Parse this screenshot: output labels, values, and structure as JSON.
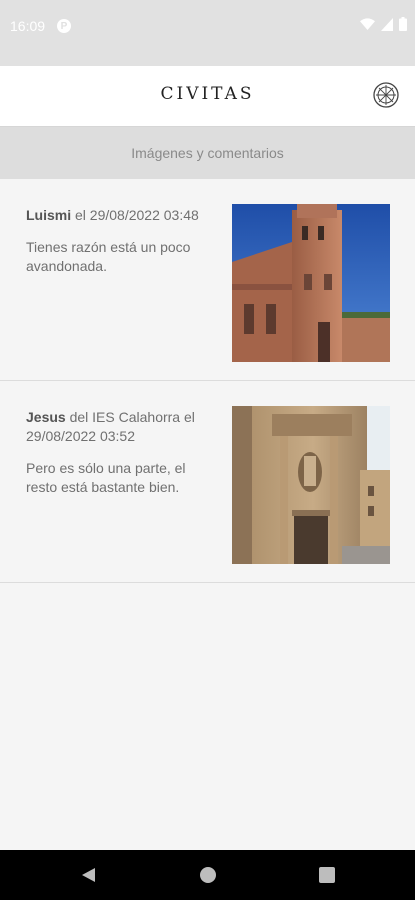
{
  "status_bar": {
    "time": "16:09",
    "notification_icon": "p-circle-icon",
    "icons": [
      "wifi-icon",
      "signal-icon",
      "battery-icon"
    ]
  },
  "app_bar": {
    "title": "CIVITAS",
    "logo_icon": "civitas-logo-icon"
  },
  "section": {
    "title": "Imágenes y comentarios"
  },
  "comments": [
    {
      "author": "Luismi",
      "meta": " el 29/08/2022 03:48",
      "text": "Tienes razón está un poco avandonada.",
      "image": "church-tower-photo"
    },
    {
      "author": "Jesus",
      "meta": " del IES Calahorra el 29/08/2022 03:52",
      "text": "Pero es sólo una parte, el resto está bastante bien.",
      "image": "cathedral-facade-photo"
    }
  ],
  "nav_bar": {
    "back": "back-icon",
    "home": "home-icon",
    "recents": "recents-icon"
  },
  "colors": {
    "status_bar": "#e1e1e1",
    "section_header": "#dddddd",
    "background": "#f5f5f5",
    "nav_bar": "#000000"
  }
}
